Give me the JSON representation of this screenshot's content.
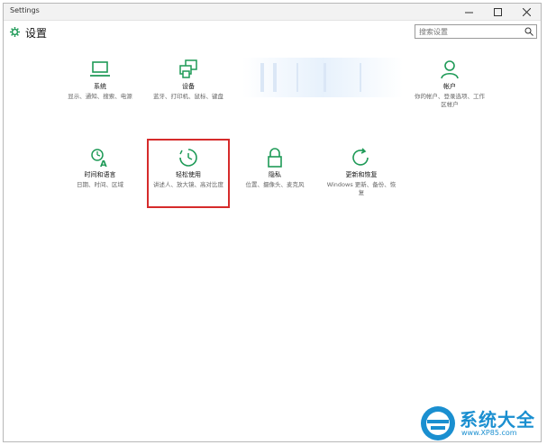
{
  "window": {
    "title": "Settings"
  },
  "header": {
    "title": "设置"
  },
  "search": {
    "placeholder": "搜索设置"
  },
  "tiles": [
    {
      "label": "系统",
      "desc": "显示、通知、搜索、电源",
      "icon": "laptop-icon"
    },
    {
      "label": "设备",
      "desc": "蓝牙、打印机、鼠标、键盘",
      "icon": "devices-icon"
    },
    {
      "label": "帐户",
      "desc": "你的帐户、登录选项、工作区帐户",
      "icon": "person-icon"
    },
    {
      "label": "时间和语言",
      "desc": "日期、时间、区域",
      "icon": "time-language-icon"
    },
    {
      "label": "轻松使用",
      "desc": "讲述人、放大镜、高对比度",
      "icon": "ease-of-access-icon"
    },
    {
      "label": "隐私",
      "desc": "位置、摄像头、麦克风",
      "icon": "lock-icon"
    },
    {
      "label": "更新和恢复",
      "desc": "Windows 更新、备份、恢复",
      "icon": "refresh-icon"
    }
  ],
  "watermark": {
    "title": "系统大全",
    "url": "www.XP85.com"
  },
  "colors": {
    "accent": "#1e9a57",
    "highlight": "#d62b2b",
    "watermark": "#1a8fd0"
  }
}
